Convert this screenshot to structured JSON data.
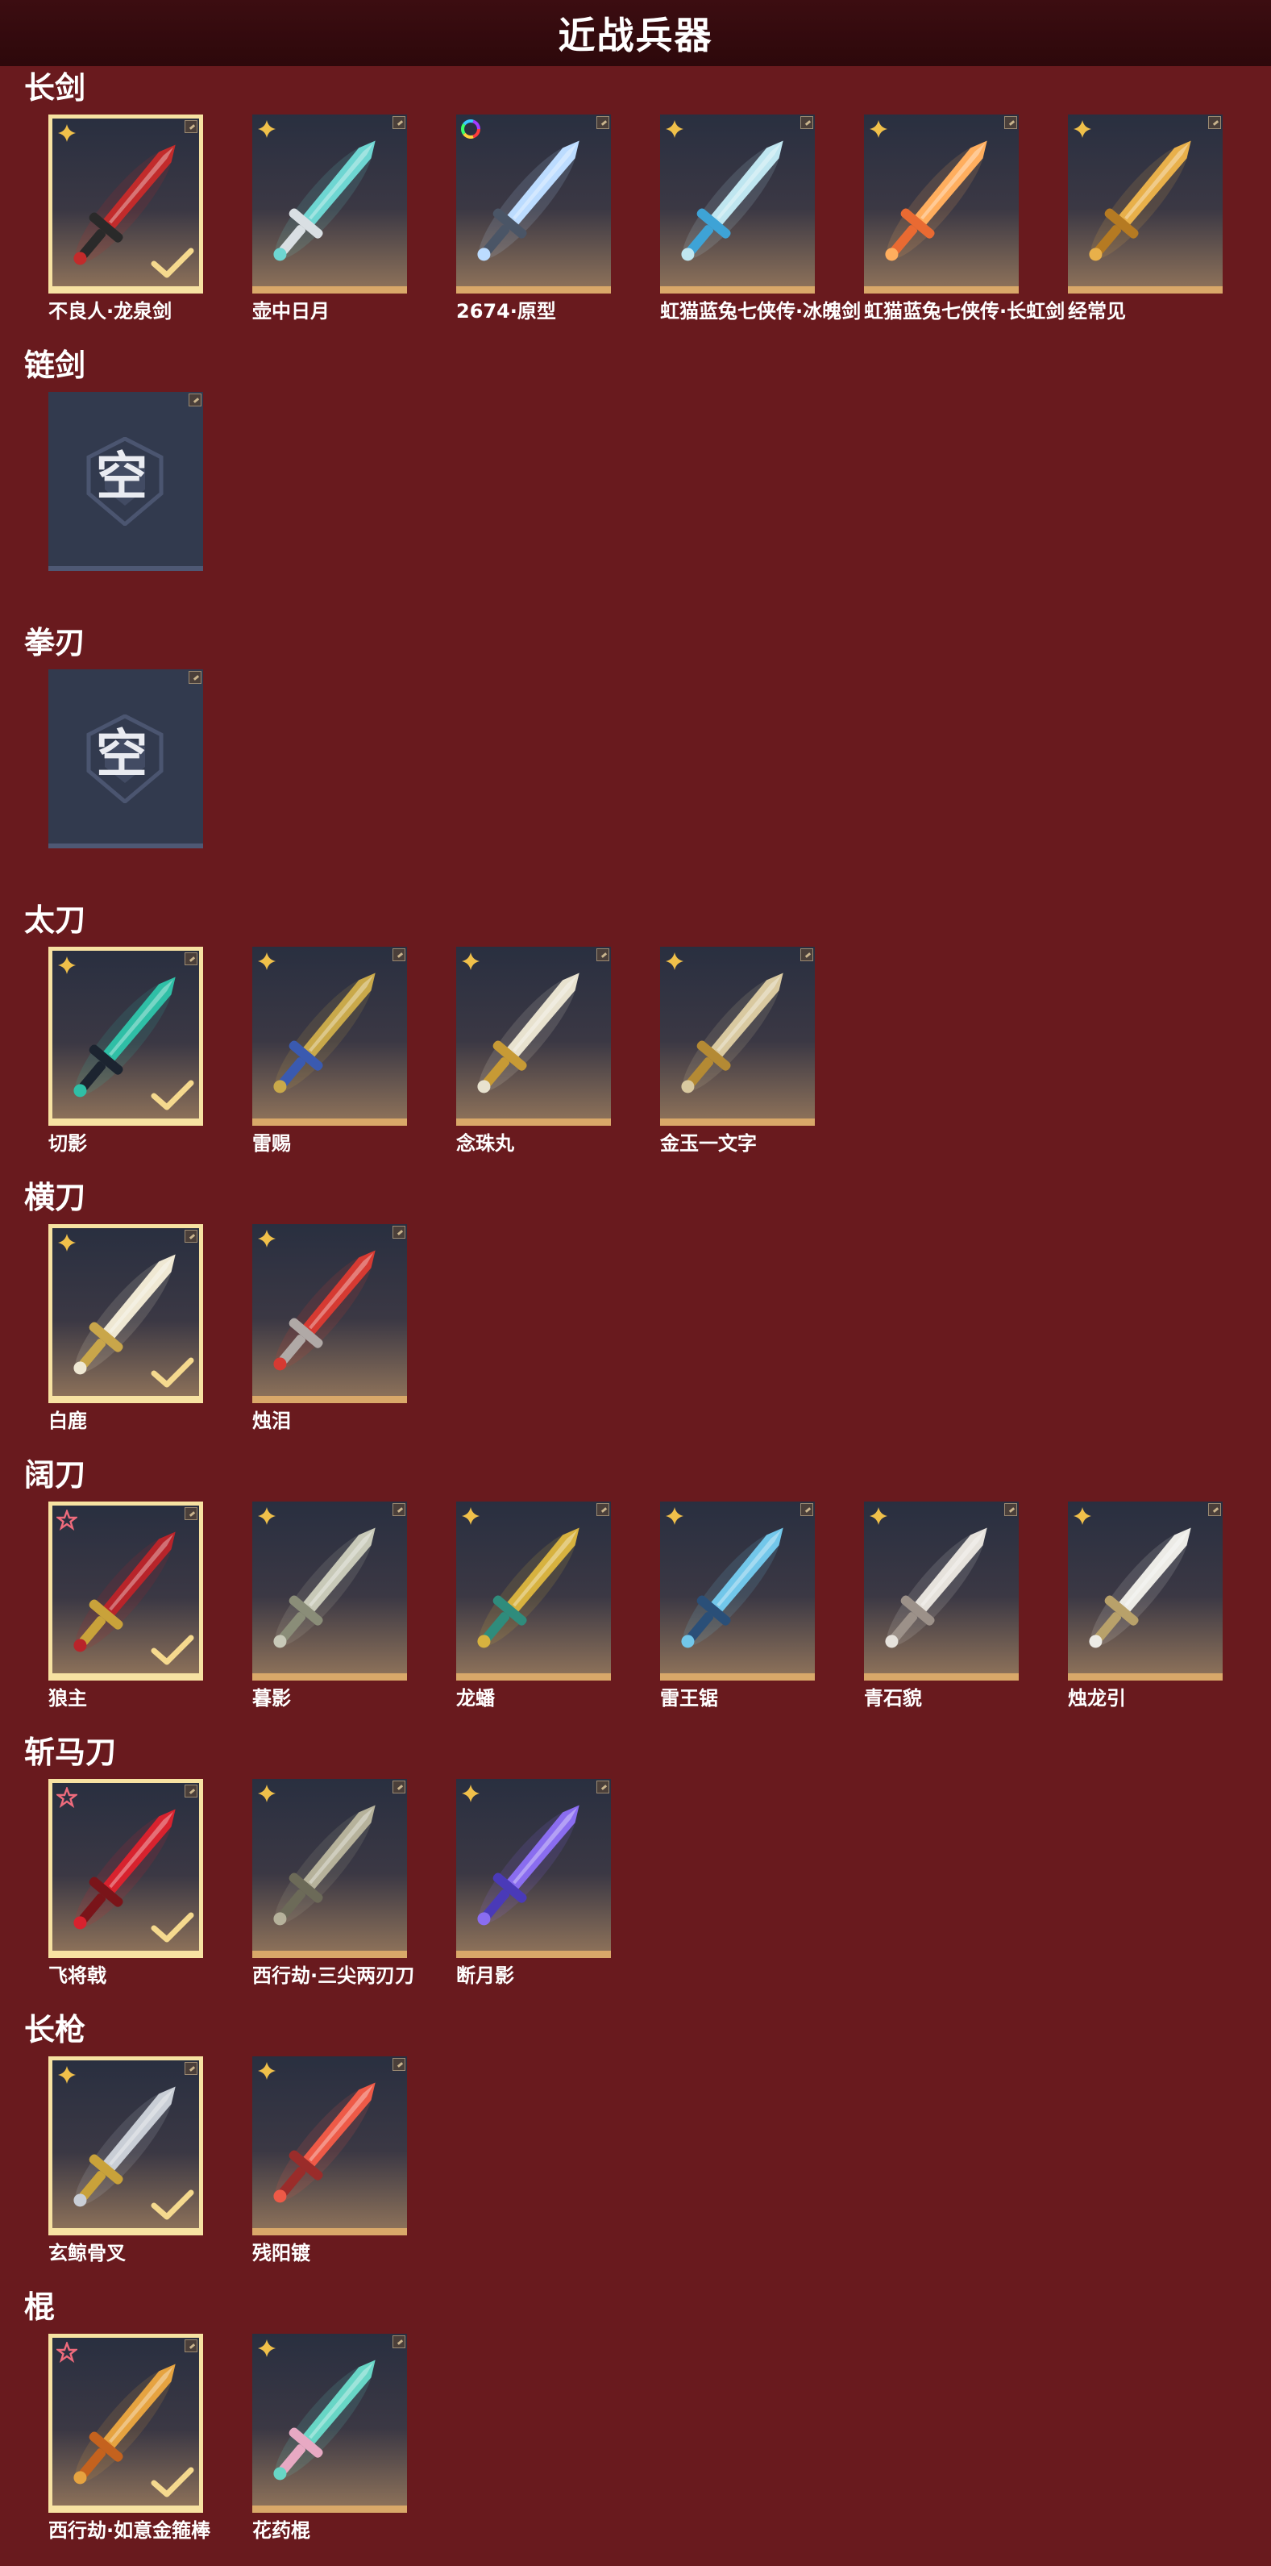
{
  "title": "近战兵器",
  "empty_label": "空",
  "sections": [
    {
      "title": "长剑",
      "items": [
        {
          "name": "不良人·龙泉剑",
          "selected": true,
          "rarity": "gold",
          "blade": "#c22b2b",
          "hilt": "#2a2a2a"
        },
        {
          "name": "壶中日月",
          "selected": false,
          "rarity": "gold",
          "blade": "#6ed6d2",
          "hilt": "#d9dfe3"
        },
        {
          "name": "2674·原型",
          "selected": false,
          "rarity": "rainbow",
          "blade": "#bcdcff",
          "hilt": "#4a5566"
        },
        {
          "name": "虹猫蓝兔七侠传·冰魄剑",
          "selected": false,
          "rarity": "gold",
          "blade": "#bfe6f0",
          "hilt": "#3ea3d6"
        },
        {
          "name": "虹猫蓝兔七侠传·长虹剑",
          "selected": false,
          "rarity": "gold",
          "blade": "#ffae5e",
          "hilt": "#e96a32"
        },
        {
          "name": "经常见",
          "selected": false,
          "rarity": "gold",
          "blade": "#e8b04a",
          "hilt": "#b57a22"
        }
      ]
    },
    {
      "title": "链剑",
      "items": [
        {
          "empty": true
        }
      ]
    },
    {
      "title": "拳刃",
      "items": [
        {
          "empty": true
        }
      ]
    },
    {
      "title": "太刀",
      "items": [
        {
          "name": "切影",
          "selected": true,
          "rarity": "gold",
          "blade": "#2fbfa6",
          "hilt": "#1c2430"
        },
        {
          "name": "雷赐",
          "selected": false,
          "rarity": "gold",
          "blade": "#c9a94a",
          "hilt": "#3a5ab0"
        },
        {
          "name": "念珠丸",
          "selected": false,
          "rarity": "gold",
          "blade": "#e8e2cf",
          "hilt": "#c79a35"
        },
        {
          "name": "金玉一文字",
          "selected": false,
          "rarity": "gold",
          "blade": "#d9c9a0",
          "hilt": "#b48a34"
        }
      ]
    },
    {
      "title": "横刀",
      "items": [
        {
          "name": "白鹿",
          "selected": true,
          "rarity": "gold",
          "blade": "#efe8d3",
          "hilt": "#c9a64a"
        },
        {
          "name": "烛泪",
          "selected": false,
          "rarity": "gold",
          "blade": "#d63a32",
          "hilt": "#b0a9a6"
        }
      ]
    },
    {
      "title": "阔刀",
      "items": [
        {
          "name": "狼主",
          "selected": true,
          "rarity": "red",
          "blade": "#b8242a",
          "hilt": "#c9a23a"
        },
        {
          "name": "暮影",
          "selected": false,
          "rarity": "gold",
          "blade": "#c8c9b8",
          "hilt": "#8a8d78"
        },
        {
          "name": "龙蟠",
          "selected": false,
          "rarity": "gold",
          "blade": "#d7b23f",
          "hilt": "#2f8c7c"
        },
        {
          "name": "雷王锯",
          "selected": false,
          "rarity": "gold",
          "blade": "#72c7ea",
          "hilt": "#2a4f78"
        },
        {
          "name": "青石貌",
          "selected": false,
          "rarity": "gold",
          "blade": "#e6e2dc",
          "hilt": "#9c9189"
        },
        {
          "name": "烛龙引",
          "selected": false,
          "rarity": "gold",
          "blade": "#ecebe6",
          "hilt": "#b8a16a"
        }
      ]
    },
    {
      "title": "斩马刀",
      "items": [
        {
          "name": "飞将戟",
          "selected": true,
          "rarity": "red",
          "blade": "#d8222e",
          "hilt": "#7a1419"
        },
        {
          "name": "西行劫·三尖两刃刀",
          "selected": false,
          "rarity": "gold",
          "blade": "#b6b29b",
          "hilt": "#6c6a58"
        },
        {
          "name": "断月影",
          "selected": false,
          "rarity": "gold",
          "blade": "#8a6df0",
          "hilt": "#4a3ab8"
        }
      ]
    },
    {
      "title": "长枪",
      "items": [
        {
          "name": "玄鲸骨叉",
          "selected": true,
          "rarity": "gold",
          "blade": "#c9ced6",
          "hilt": "#c9a23a"
        },
        {
          "name": "残阳镀",
          "selected": false,
          "rarity": "gold",
          "blade": "#ee5a47",
          "hilt": "#9a2c2a"
        }
      ]
    },
    {
      "title": "棍",
      "items": [
        {
          "name": "西行劫·如意金箍棒",
          "selected": true,
          "rarity": "red",
          "blade": "#e6a340",
          "hilt": "#c4621e"
        },
        {
          "name": "花药棍",
          "selected": false,
          "rarity": "gold",
          "blade": "#68d6c6",
          "hilt": "#e7a9c3"
        }
      ]
    }
  ]
}
